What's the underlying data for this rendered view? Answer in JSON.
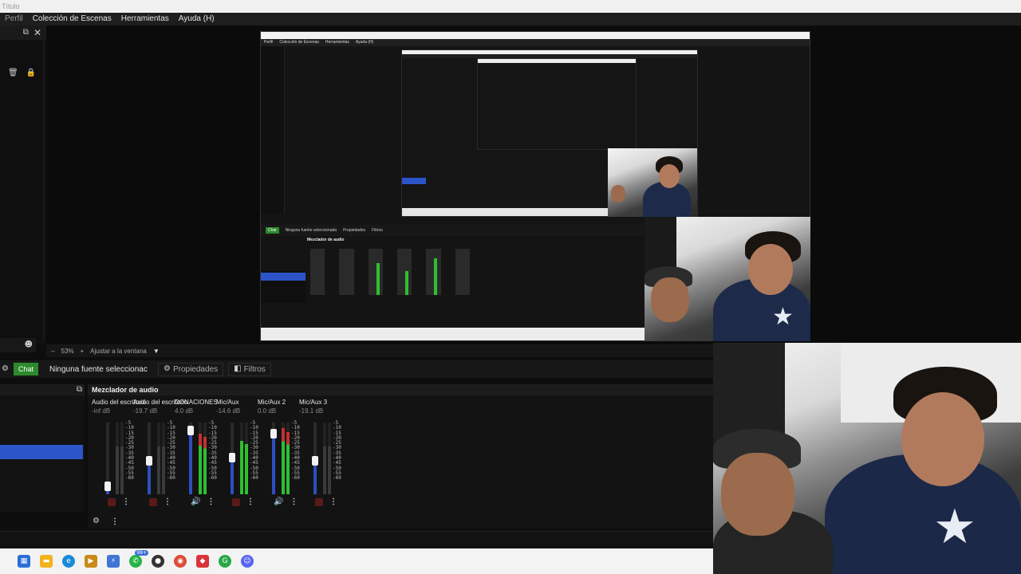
{
  "window": {
    "title": "Título"
  },
  "menu": {
    "items": [
      "Perfil",
      "Colección de Escenas",
      "Herramientas",
      "Ayuda (H)"
    ]
  },
  "preview": {
    "inner_menu": [
      "Perfil",
      "Colección de Escenas",
      "Herramientas",
      "Ayuda (H)"
    ],
    "inner_source_label": "Ninguna fuente seleccionada",
    "inner_props": "Propiedades",
    "inner_filters": "Filtros",
    "inner_mixer_title": "Mezclador de audio"
  },
  "toolbar": {
    "zoom": "53%",
    "fit_label": "Ajustar a la ventana"
  },
  "sources_bar": {
    "chat_label": "Chat",
    "source_label": "Ninguna fuente seleccionac",
    "properties_label": "Propiedades",
    "filters_label": "Filtros"
  },
  "mixer": {
    "title": "Mezclador de audio",
    "scale": [
      "-5",
      "-10",
      "-15",
      "-20",
      "-25",
      "-30",
      "-35",
      "-40",
      "-45",
      "-50",
      "-55",
      "-60"
    ],
    "channels": [
      {
        "name": "Audio del escritorio",
        "db": "-inf dB",
        "fader": 0.12,
        "level": 0.0,
        "muted": true
      },
      {
        "name": "Audio del escritorio",
        "db": "-19.7 dB",
        "fader": 0.5,
        "level": 0.0,
        "muted": true
      },
      {
        "name": "DONACIONES",
        "db": "4.0 dB",
        "fader": 0.95,
        "level": 0.85,
        "muted": false
      },
      {
        "name": "Mic/Aux",
        "db": "-14.6 dB",
        "fader": 0.55,
        "level": 0.75,
        "muted": true
      },
      {
        "name": "Mic/Aux 2",
        "db": "0.0 dB",
        "fader": 0.9,
        "level": 0.92,
        "muted": false
      },
      {
        "name": "Mic/Aux 3",
        "db": "-19.1 dB",
        "fader": 0.5,
        "level": 0.0,
        "muted": true
      }
    ]
  },
  "taskbar": {
    "badge": "99+"
  },
  "colors": {
    "accent_blue": "#2c55c8",
    "chat_green": "#2c8a2c",
    "meter_green": "#2fbf2f",
    "meter_red": "#c23030"
  }
}
